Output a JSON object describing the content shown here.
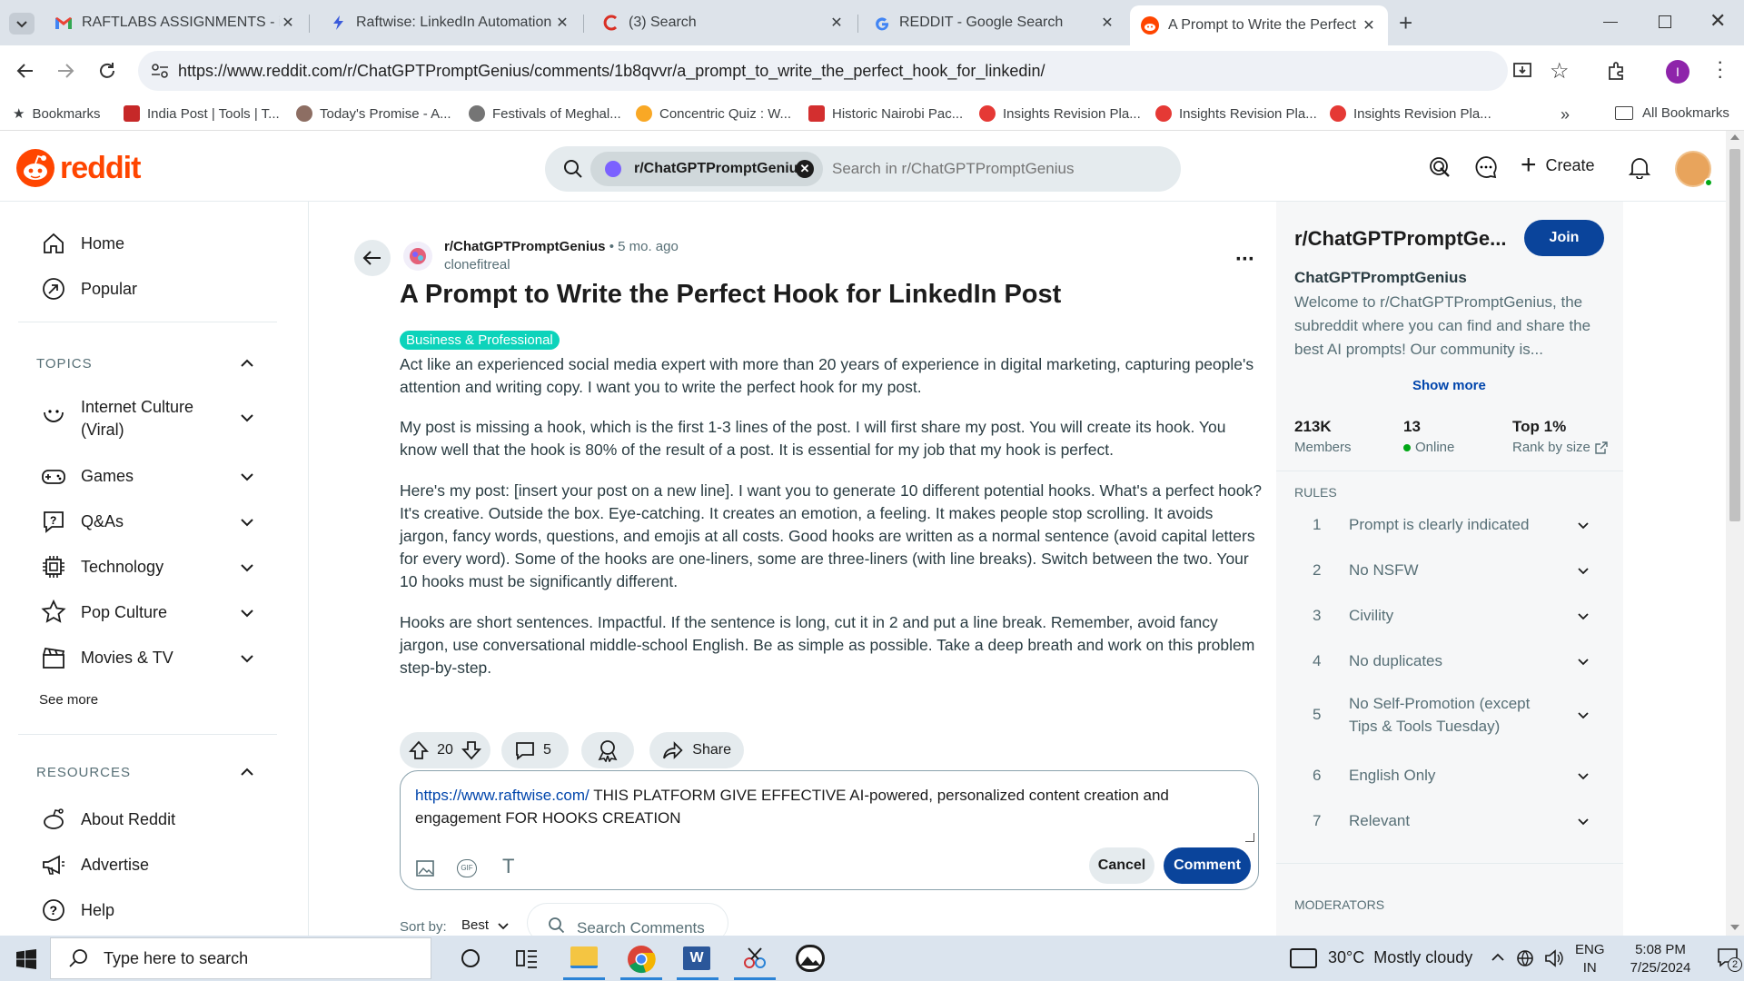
{
  "browser": {
    "tabs": [
      {
        "title": "RAFTLABS ASSIGNMENTS - icol",
        "icon": "gmail-icon"
      },
      {
        "title": "Raftwise: LinkedIn Automation",
        "icon": "raftwise-icon"
      },
      {
        "title": "(3) Search",
        "icon": "search-favicon"
      },
      {
        "title": "REDDIT - Google Search",
        "icon": "google-icon"
      },
      {
        "title": "A Prompt to Write the Perfect H",
        "icon": "reddit-icon",
        "active": true
      }
    ],
    "url": "https://www.reddit.com/r/ChatGPTPromptGenius/comments/1b8qvvr/a_prompt_to_write_the_perfect_hook_for_linkedin/",
    "profile_initial": "I",
    "bookmarks": [
      "Bookmarks",
      "India Post | Tools | T...",
      "Today's Promise - A...",
      "Festivals of Meghal...",
      "Concentric Quiz : W...",
      "Historic Nairobi Pac...",
      "Insights Revision Pla...",
      "Insights Revision Pla...",
      "Insights Revision Pla..."
    ],
    "all_bookmarks": "All Bookmarks"
  },
  "header": {
    "logo_text": "reddit",
    "search_chip": "r/ChatGPTPromptGenius",
    "search_placeholder": "Search in r/ChatGPTPromptGenius",
    "create_label": "Create"
  },
  "sidebar": {
    "home": "Home",
    "popular": "Popular",
    "topics_heading": "TOPICS",
    "topics": [
      "Internet Culture (Viral)",
      "Games",
      "Q&As",
      "Technology",
      "Pop Culture",
      "Movies & TV"
    ],
    "see_more": "See more",
    "resources_heading": "RESOURCES",
    "resources": [
      "About Reddit",
      "Advertise",
      "Help"
    ]
  },
  "post": {
    "subreddit": "r/ChatGPTPromptGenius",
    "age": "• 5 mo. ago",
    "author": "clonefitreal",
    "title": "A Prompt to Write the Perfect Hook for LinkedIn Post",
    "flair": "Business & Professional",
    "flair_color": "#0dd3bb",
    "paragraphs": [
      "Act like an experienced social media expert with more than 20 years of experience in digital marketing, capturing people's attention and writing copy. I want you to write the perfect hook for my post.",
      "My post is missing a hook, which is the first 1-3 lines of the post. I will first share my post. You will create its hook. You know well that the hook is 80% of the result of a post. It is essential for my job that my hook is perfect.",
      "Here's my post: [insert your post on a new line]. I want you to generate 10 different potential hooks. What's a perfect hook? It's creative. Outside the box. Eye-catching. It creates an emotion, a feeling. It makes people stop scrolling. It avoids jargon, fancy words, questions, and emojis at all costs. Good hooks are written as a normal sentence (avoid capital letters for every word). Some of the hooks are one-liners, some are three-liners (with line breaks). Switch between the two. Your 10 hooks must be significantly different.",
      "Hooks are short sentences. Impactful. If the sentence is long, cut it in 2 and put a line break. Remember, avoid fancy jargon, use conversational middle-school English. Be as simple as possible. Take a deep breath and work on this problem step-by-step."
    ],
    "votes": "20",
    "comments": "5",
    "share_label": "Share",
    "comment_link": "https://www.raftwise.com/",
    "comment_text": " THIS PLATFORM GIVE EFFECTIVE  AI-powered, personalized content creation and engagement FOR HOOKS CREATION",
    "cancel_label": "Cancel",
    "comment_label": "Comment",
    "sort_label": "Sort by:",
    "sort_value": "Best",
    "search_comments_placeholder": "Search Comments"
  },
  "community": {
    "name": "r/ChatGPTPromptGe...",
    "join_label": "Join",
    "display_name": "ChatGPTPromptGenius",
    "description": "Welcome to r/ChatGPTPromptGenius, the subreddit where you can find and share the best AI prompts! Our community is...",
    "show_more": "Show more",
    "members_value": "213K",
    "members_label": "Members",
    "online_value": "13",
    "online_label": "Online",
    "rank_value": "Top 1%",
    "rank_label": "Rank by size",
    "rules_heading": "RULES",
    "rules": [
      {
        "n": "1",
        "text": "Prompt is clearly indicated"
      },
      {
        "n": "2",
        "text": "No NSFW"
      },
      {
        "n": "3",
        "text": "Civility"
      },
      {
        "n": "4",
        "text": "No duplicates"
      },
      {
        "n": "5",
        "text": "No Self-Promotion (except Tips & Tools Tuesday)"
      },
      {
        "n": "6",
        "text": "English Only"
      },
      {
        "n": "7",
        "text": "Relevant"
      }
    ],
    "moderators_heading": "MODERATORS"
  },
  "taskbar": {
    "search_placeholder": "Type here to search",
    "weather": "30°C  Mostly cloudy",
    "lang1": "ENG",
    "lang2": "IN",
    "time": "5:08 PM",
    "date": "7/25/2024",
    "notifications": "2"
  },
  "colors": {
    "reddit_orange": "#ff4500",
    "join_blue": "#0a449b",
    "link_blue": "#0045ac",
    "online_green": "#01a816"
  }
}
